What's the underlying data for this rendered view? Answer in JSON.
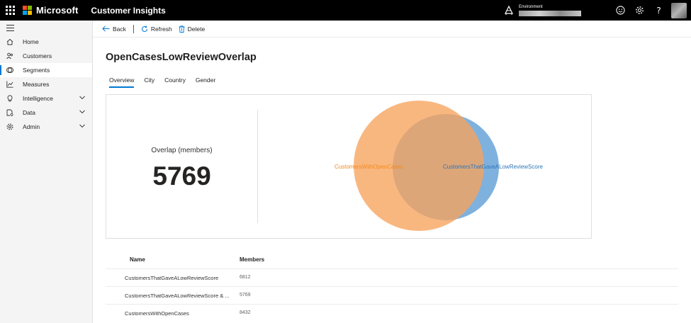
{
  "topbar": {
    "brand": "Microsoft",
    "app_name": "Customer Insights",
    "environment_label": "Environment",
    "icons": [
      "waffle-icon",
      "environment-icon",
      "smiley-icon",
      "settings-gear-icon",
      "help-icon",
      "avatar"
    ]
  },
  "colors": {
    "accent": "#0078d4",
    "segment_a": "#f7a35c",
    "segment_b": "#5b9bd5",
    "overlap": "#c4946a",
    "label_a": "#f28a1e",
    "label_b": "#2e75b6"
  },
  "sidebar": {
    "items": [
      {
        "label": "Home",
        "icon": "home-icon"
      },
      {
        "label": "Customers",
        "icon": "customers-icon"
      },
      {
        "label": "Segments",
        "icon": "segments-icon",
        "active": true
      },
      {
        "label": "Measures",
        "icon": "measures-icon"
      },
      {
        "label": "Intelligence",
        "icon": "lightbulb-icon",
        "expandable": true
      },
      {
        "label": "Data",
        "icon": "data-icon",
        "expandable": true
      },
      {
        "label": "Admin",
        "icon": "gear-icon",
        "expandable": true
      }
    ]
  },
  "commands": {
    "back": "Back",
    "refresh": "Refresh",
    "delete": "Delete"
  },
  "page": {
    "title": "OpenCasesLowReviewOverlap",
    "tabs": [
      "Overview",
      "City",
      "Country",
      "Gender"
    ],
    "active_tab": "Overview"
  },
  "overlap": {
    "label": "Overlap (members)",
    "value": "5769",
    "segment_a": "CustomersWithOpenCases",
    "segment_b": "CustomersThatGaveALowReviewScore"
  },
  "table": {
    "headers": [
      "Name",
      "Members"
    ],
    "rows": [
      {
        "name": "CustomersThatGaveALowReviewScore",
        "members": "6812"
      },
      {
        "name": "CustomersThatGaveALowReviewScore & ...",
        "members": "5769"
      },
      {
        "name": "CustomersWithOpenCases",
        "members": "8432"
      }
    ]
  }
}
